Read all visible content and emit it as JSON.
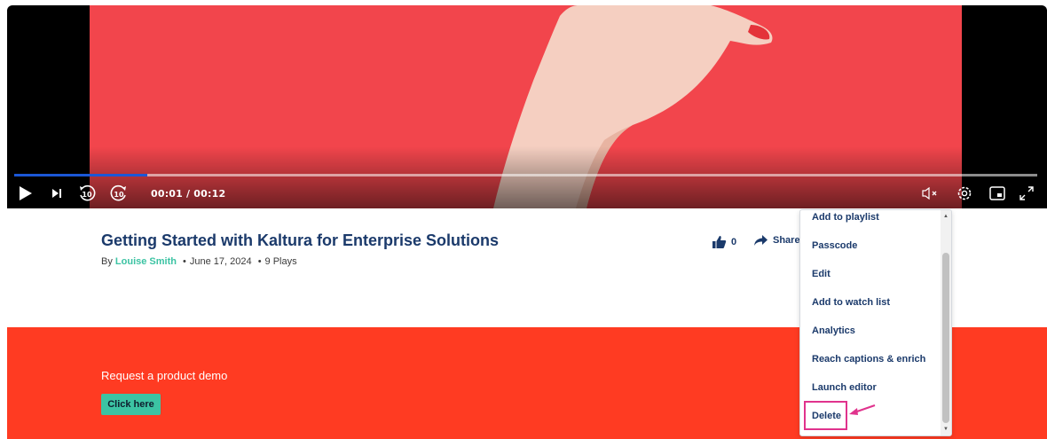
{
  "player": {
    "time_readout": "00:01 / 00:12",
    "progress_percent": 13,
    "progress_color": "#1b57d6",
    "video_background_color": "#f2454c",
    "controls": {
      "play_icon": "play-icon",
      "next_icon": "skip-next-icon",
      "rewind_label": "10",
      "forward_label": "10",
      "volume_icon": "volume-muted-icon",
      "settings_icon": "gear-icon",
      "pip_icon": "picture-in-picture-icon",
      "fullscreen_icon": "fullscreen-icon"
    }
  },
  "media": {
    "title": "Getting Started with Kaltura for Enterprise Solutions",
    "by_prefix": "By",
    "author": "Louise Smith",
    "date": "June 17, 2024",
    "plays": "9 Plays",
    "likes": "0",
    "share_label": "Share"
  },
  "menu": {
    "items": [
      "Add to playlist",
      "Passcode",
      "Edit",
      "Add to watch list",
      "Analytics",
      "Reach captions & enrich",
      "Launch editor",
      "Delete"
    ],
    "highlighted_item": "Delete",
    "highlight_color": "#e0338d"
  },
  "banner": {
    "text": "Request a product demo",
    "button_label": "Click here",
    "background_color": "#ff3b22",
    "button_color": "#3cc3a3"
  },
  "colors": {
    "title": "#1b3a6b",
    "author": "#3cc3a3"
  }
}
